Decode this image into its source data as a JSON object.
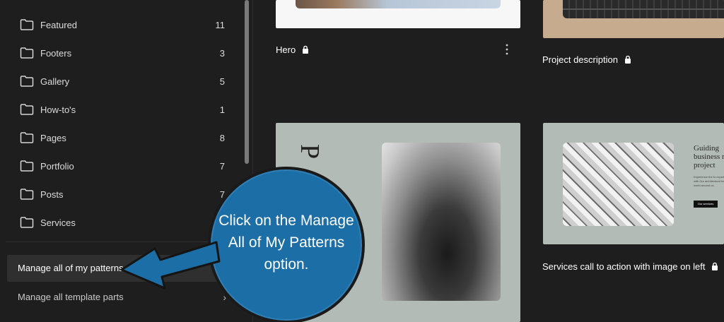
{
  "sidebar": {
    "categories": [
      {
        "label": "Featured",
        "count": "11",
        "icon": "folder-icon"
      },
      {
        "label": "Footers",
        "count": "3",
        "icon": "folder-icon"
      },
      {
        "label": "Gallery",
        "count": "5",
        "icon": "folder-icon"
      },
      {
        "label": "How-to's",
        "count": "1",
        "icon": "folder-icon"
      },
      {
        "label": "Pages",
        "count": "8",
        "icon": "folder-icon"
      },
      {
        "label": "Portfolio",
        "count": "7",
        "icon": "folder-icon"
      },
      {
        "label": "Posts",
        "count": "7",
        "icon": "folder-icon"
      },
      {
        "label": "Services",
        "count": "",
        "icon": "folder-icon"
      }
    ],
    "manage_patterns_label": "Manage all of my patterns",
    "manage_template_parts_label": "Manage all template parts"
  },
  "patterns": {
    "hero_title": "Hero",
    "project_title": "Project description",
    "services_title": "Services call to action with image on left",
    "services_preview": {
      "heading": "Guiding business n project",
      "body": "Experience the fu expertise with Our architectural transf world around us.",
      "button": "Our services"
    },
    "p_preview_letter": "P"
  },
  "callout": {
    "text": "Click on the Manage All of My Patterns option."
  },
  "colors": {
    "background": "#1e1e1e",
    "selected_item": "#2f2f2f",
    "callout_blue": "#1c6fa6",
    "card_sage": "#b3bbb7",
    "card_tan": "#c7ab8f"
  }
}
